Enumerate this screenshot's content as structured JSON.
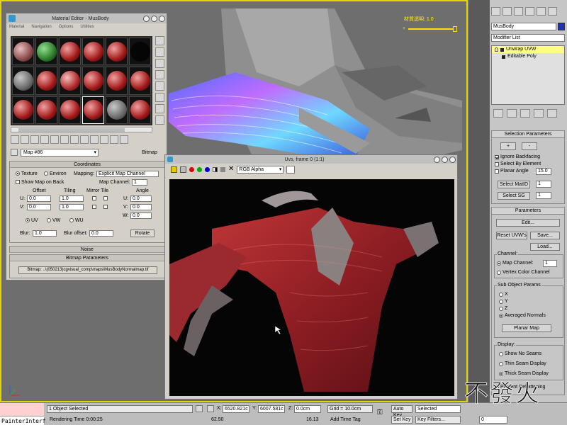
{
  "viewport": {
    "label": "材質透明: 1.0",
    "slider_min": "+",
    "slider_max": "+"
  },
  "command_panel": {
    "object_name": "MusBody",
    "modifier_list": "Modifier List",
    "stack": [
      {
        "label": "Unwrap UVW",
        "selected": true
      },
      {
        "label": "Editable Poly",
        "selected": false
      }
    ],
    "selection_params": {
      "title": "Selection Parameters",
      "plus": "+",
      "minus": "-",
      "ignore_backfacing": "Ignore Backfacing",
      "select_by_element": "Select By Element",
      "planar_angle": "Planar Angle",
      "planar_angle_value": "15.0",
      "select_matid": "Select MatID",
      "matid_value": "1",
      "select_sg": "Select SG",
      "sg_value": "1"
    },
    "parameters": {
      "title": "Parameters",
      "edit": "Edit...",
      "reset_uvws": "Reset UVW's",
      "save": "Save...",
      "load": "Load...",
      "channel_group": "Channel:",
      "map_channel": "Map Channel:",
      "map_channel_value": "1",
      "vertex_color_channel": "Vertex Color Channel",
      "sub_object_group": "Sub Object Params",
      "axis_x": "X",
      "axis_y": "Y",
      "axis_z": "Z",
      "averaged_normals": "Averaged Normals",
      "planar_map": "Planar Map",
      "display_group": "Display:",
      "show_no_seams": "Show No Seams",
      "thin_seam_display": "Thin Seam Display",
      "thick_seam_display": "Thick Seam Display",
      "prevent_reflattening": "Prevent Reflattening"
    }
  },
  "material_editor": {
    "title": "Material Editor - MusBody",
    "menu": [
      "Material",
      "Navigation",
      "Options",
      "Utilities"
    ],
    "map_name": "Map #86",
    "map_type": "Bitmap",
    "coordinates": {
      "title": "Coordinates",
      "texture": "Texture",
      "environ": "Environ",
      "mapping_label": "Mapping:",
      "mapping_value": "Explicit Map Channel",
      "show_map_on_back": "Show Map on Back",
      "map_channel_label": "Map Channel:",
      "map_channel_value": "1",
      "offset": "Offset",
      "tiling": "Tiling",
      "mirror_tile": "Mirror Tile",
      "angle": "Angle",
      "u_label": "U:",
      "v_label": "V:",
      "w_label": "W:",
      "u_offset": "0.0",
      "v_offset": "0.0",
      "u_tiling": "1.0",
      "v_tiling": "1.0",
      "u_angle": "0.0",
      "v_angle": "0.0",
      "w_angle": "0.0",
      "uv": "UV",
      "vw": "VW",
      "wu": "WU",
      "blur_label": "Blur:",
      "blur_value": "1.0",
      "blur_offset_label": "Blur offset:",
      "blur_offset_value": "0.0",
      "rotate": "Rotate"
    },
    "noise_title": "Noise",
    "bitmap_params_title": "Bitmap Parameters",
    "bitmap_path": "Bitmap: ..\\(050213)cgvisual_comp\\maps\\MusBodyNormalmap.tif"
  },
  "render_frame": {
    "title": "Uvs, frame 0 (1:1)",
    "channel": "RGB Alpha",
    "colors": {
      "red": "#dd0000",
      "green": "#00aa00",
      "blue": "#0000cc"
    }
  },
  "status_bar": {
    "maxscript": "PainterInterf",
    "selection": "1 Object Selected",
    "prompt": "Rendering Time 0:00:25",
    "x_label": "X:",
    "x_value": "6520.821c",
    "y_label": "Y:",
    "y_value": "6007.581c",
    "z_label": "Z:",
    "z_value": "0.0cm",
    "grid": "Grid = 10.0cm",
    "add_time_tag": "Add Time Tag",
    "auto_key": "Auto Key",
    "set_key": "Set Key",
    "selected": "Selected",
    "key_filters": "Key Filters...",
    "time_left": "62.50",
    "time_right": "16.13",
    "frame": "0"
  },
  "watermark": "不發火"
}
